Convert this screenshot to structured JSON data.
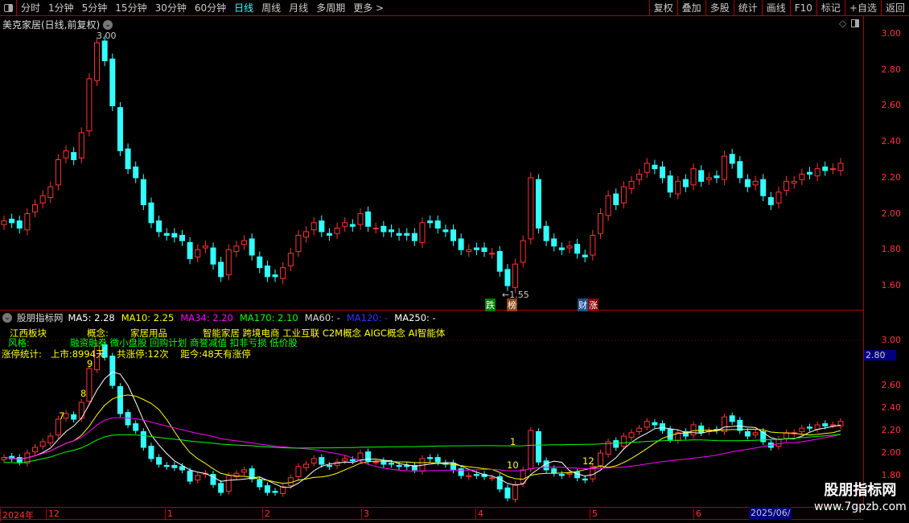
{
  "toolbar": {
    "periods": [
      "分时",
      "1分钟",
      "5分钟",
      "15分钟",
      "30分钟",
      "60分钟",
      "日线",
      "周线",
      "月线",
      "多周期",
      "更多 >"
    ],
    "active": "日线",
    "buttons": [
      "复权",
      "叠加",
      "多股",
      "统计",
      "画线",
      "F10",
      "标记",
      "+自选",
      "返回"
    ]
  },
  "title": "美克家居(日线,前复权)",
  "price_axis_top": [
    "3.00",
    "2.80",
    "2.60",
    "2.40",
    "2.20",
    "2.00",
    "1.80",
    "1.60"
  ],
  "price_axis_bottom": [
    "3.00",
    "2.60",
    "2.40",
    "2.20",
    "2.00",
    "1.80"
  ],
  "current_price_label": "2.80",
  "annotations": {
    "high": "3.00",
    "low": "1.55"
  },
  "tags": [
    {
      "text": "跌",
      "color": "#008000"
    },
    {
      "text": "榜",
      "color": "#8b4513"
    },
    {
      "text": "财",
      "color": "#1f4e8c"
    },
    {
      "text": "涨",
      "color": "#8b0000"
    }
  ],
  "indicator": {
    "name": "股朋指标网",
    "ma": [
      {
        "t": "MA5: 2.28",
        "c": "#ffffff"
      },
      {
        "t": "MA10: 2.25",
        "c": "#ffff00"
      },
      {
        "t": "MA34: 2.20",
        "c": "#ff00ff"
      },
      {
        "t": "MA170: 2.10",
        "c": "#00ff00"
      },
      {
        "t": "MA60: -",
        "c": "#dddddd"
      },
      {
        "t": "MA120: -",
        "c": "#3030ff"
      },
      {
        "t": "MA250: -",
        "c": "#ffffff"
      }
    ],
    "sector_label": "江西板块",
    "concept_label": "概念:",
    "concepts": "家居用品            智能家居 跨境电商 工业互联 C2M概念 AIGC概念 AI智能体",
    "style_label": "风格:",
    "styles": "融资融券 微小盘股 回购计划 商誉减值 扣非亏损 低价股",
    "limit_stats": "涨停统计:   上市:8994天    共涨停:12次    距今:48天有涨停",
    "counts": [
      "7",
      "8",
      "9",
      "1",
      "10",
      "12"
    ]
  },
  "date_axis": [
    "2024年",
    "12",
    "1",
    "2",
    "3",
    "4",
    "5",
    "6"
  ],
  "current_date": "2025/06/",
  "watermark": {
    "name": "股朋指标网",
    "url": "www.7gpzb.com"
  },
  "closes": [
    1.96,
    1.95,
    1.92,
    2.0,
    2.05,
    2.1,
    2.15,
    2.3,
    2.35,
    2.3,
    2.45,
    2.75,
    2.95,
    2.85,
    2.6,
    2.35,
    2.25,
    2.2,
    2.05,
    1.95,
    1.9,
    1.88,
    1.87,
    1.85,
    1.75,
    1.8,
    1.82,
    1.72,
    1.65,
    1.8,
    1.82,
    1.85,
    1.77,
    1.7,
    1.65,
    1.65,
    1.7,
    1.78,
    1.88,
    1.9,
    1.95,
    1.9,
    1.88,
    1.92,
    1.95,
    1.93,
    2.0,
    1.93,
    1.92,
    1.9,
    1.9,
    1.88,
    1.88,
    1.85,
    1.95,
    1.95,
    1.92,
    1.9,
    1.85,
    1.8,
    1.8,
    1.8,
    1.79,
    1.78,
    1.68,
    1.6,
    1.72,
    1.85,
    2.2,
    1.92,
    1.85,
    1.82,
    1.8,
    1.82,
    1.78,
    1.76,
    1.88,
    2.0,
    2.1,
    2.05,
    2.15,
    2.18,
    2.22,
    2.28,
    2.25,
    2.2,
    2.12,
    2.18,
    2.15,
    2.25,
    2.18,
    2.2,
    2.2,
    2.32,
    2.28,
    2.2,
    2.15,
    2.18,
    2.1,
    2.05,
    2.12,
    2.18,
    2.18,
    2.22,
    2.22,
    2.25,
    2.24,
    2.25,
    2.28
  ]
}
